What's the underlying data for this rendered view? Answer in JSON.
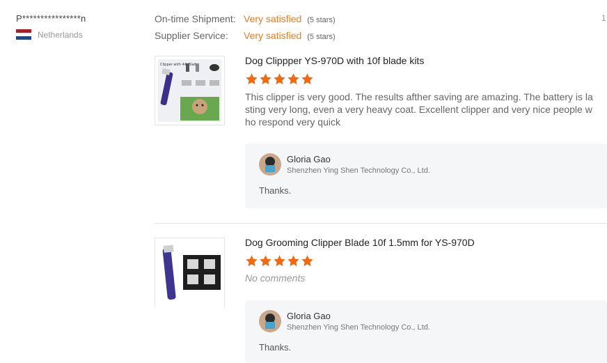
{
  "buyer": {
    "name": "P****************n",
    "country": "Netherlands",
    "flag_colors": [
      "#ae1c28",
      "#ffffff",
      "#21468b"
    ]
  },
  "ratings": [
    {
      "label": "On-time Shipment:",
      "value": "Very satisfied",
      "stars": "(5 stars)"
    },
    {
      "label": "Supplier Service:",
      "value": "Very satisfied",
      "stars": "(5 stars)"
    }
  ],
  "page_number": "1",
  "colors": {
    "accent": "#f27a1a",
    "star": "#f26a10",
    "reply_bg": "#f5f6f8"
  },
  "reviews": [
    {
      "product_title": "Dog Clippper YS-970D with 10f blade kits",
      "rating": 5,
      "text": "This clipper is very good. The results afther saving are amazing. The battery is lasting very long, even a very heavy coat. Excellent clipper and very nice people who respond very quick",
      "thumb_icon": "clipper-kit-product-image",
      "thumb_text": "Clipper with 4# Blade",
      "reply": {
        "name": "Gloria Gao",
        "company": "Shenzhen Ying Shen Technology Co., Ltd.",
        "text": "Thanks."
      }
    },
    {
      "product_title": "Dog Grooming Clipper Blade 10f 1.5mm for YS-970D",
      "rating": 5,
      "text": "No comments",
      "thumb_icon": "clipper-blades-product-image",
      "reply": {
        "name": "Gloria Gao",
        "company": "Shenzhen Ying Shen Technology Co., Ltd.",
        "text": "Thanks."
      }
    }
  ]
}
